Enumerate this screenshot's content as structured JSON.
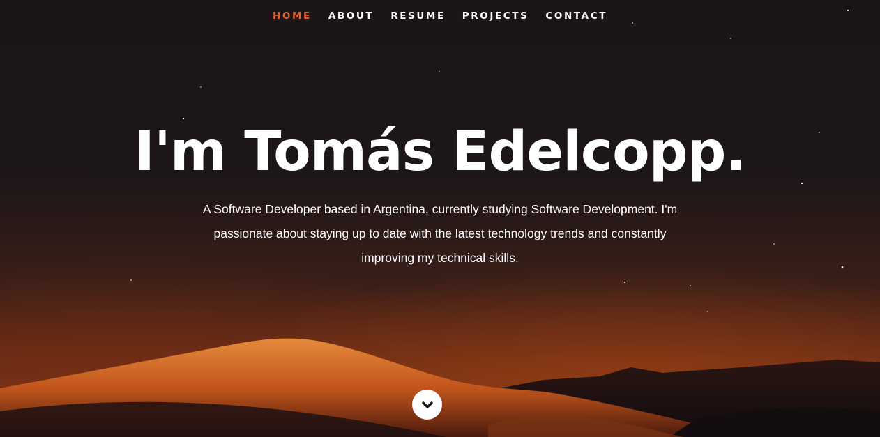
{
  "nav": {
    "items": [
      {
        "label": "HOME",
        "active": true
      },
      {
        "label": "ABOUT",
        "active": false
      },
      {
        "label": "RESUME",
        "active": false
      },
      {
        "label": "PROJECTS",
        "active": false
      },
      {
        "label": "CONTACT",
        "active": false
      }
    ]
  },
  "hero": {
    "title": "I'm Tomás Edelcopp.",
    "description": "A Software Developer based in Argentina, currently studying Software Development. I'm passionate about staying up to date with the latest technology trends and constantly improving my technical skills."
  },
  "scroll_button": {
    "icon": "chevron-down-icon"
  },
  "colors": {
    "accent": "#e0612c",
    "text": "#ffffff",
    "background": "#1a1416"
  }
}
